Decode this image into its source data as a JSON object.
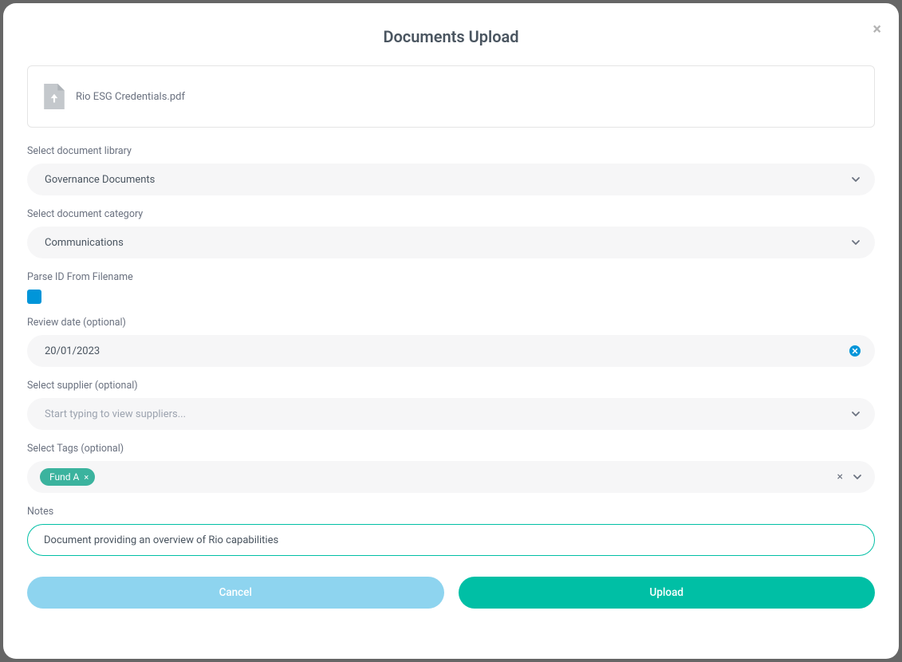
{
  "modal": {
    "title": "Documents Upload",
    "file": {
      "name": "Rio ESG Credentials.pdf"
    },
    "library": {
      "label": "Select document library",
      "value": "Governance Documents"
    },
    "category": {
      "label": "Select document category",
      "value": "Communications"
    },
    "parse_id": {
      "label": "Parse ID From Filename",
      "checked": true
    },
    "review_date": {
      "label": "Review date (optional)",
      "value": "20/01/2023"
    },
    "supplier": {
      "label": "Select supplier (optional)",
      "placeholder": "Start typing to view suppliers..."
    },
    "tags": {
      "label": "Select Tags (optional)",
      "items": [
        {
          "label": "Fund A"
        }
      ]
    },
    "notes": {
      "label": "Notes",
      "value": "Document providing an overview of Rio capabilities"
    },
    "buttons": {
      "cancel": "Cancel",
      "upload": "Upload"
    }
  }
}
